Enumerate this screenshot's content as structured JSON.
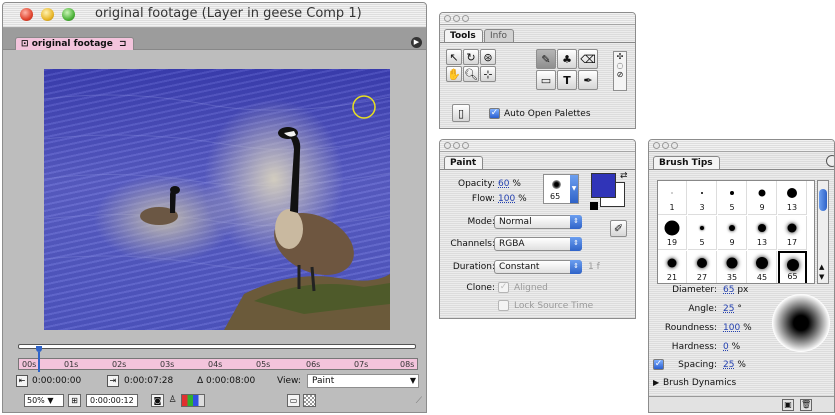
{
  "comp_window": {
    "title": "original footage (Layer in geese Comp 1)",
    "tab_label": "original footage",
    "timeline": {
      "ticks": [
        "00s",
        "01s",
        "02s",
        "03s",
        "04s",
        "05s",
        "06s",
        "07s",
        "08s"
      ]
    },
    "status_row1": {
      "current_time": "0:00:00:00",
      "out_time": "0:00:07:28",
      "duration_prefix": "Δ",
      "duration": "0:00:08:00",
      "view_label": "View:",
      "view_value": "Paint"
    },
    "status_row2": {
      "zoom": "50%",
      "time": "0:00:00:12"
    },
    "colors": {
      "tab_pink": "#f3c4dc",
      "paint_overlay": "#3c3fb5"
    }
  },
  "tools_window": {
    "tabs": [
      "Tools",
      "Info"
    ],
    "auto_open_label": "Auto Open Palettes",
    "auto_open_checked": true,
    "text_tool_glyph": "T"
  },
  "paint_window": {
    "tab_label": "Paint",
    "opacity_label": "Opacity:",
    "opacity_value": "60",
    "opacity_unit": "%",
    "flow_label": "Flow:",
    "flow_value": "100",
    "flow_unit": "%",
    "brush_size": "65",
    "mode_label": "Mode:",
    "mode_value": "Normal",
    "channels_label": "Channels:",
    "channels_value": "RGBA",
    "duration_label": "Duration:",
    "duration_value": "Constant",
    "duration_extra": "1 f",
    "clone_label": "Clone:",
    "aligned_label": "Aligned",
    "lock_source_label": "Lock Source Time",
    "foreground_color": "#3034b8",
    "background_color": "#ffffff"
  },
  "brush_tips_window": {
    "tab_label": "Brush Tips",
    "tips": [
      [
        "1",
        "3",
        "5",
        "9",
        "13"
      ],
      [
        "19",
        "5",
        "9",
        "13",
        "17"
      ],
      [
        "21",
        "27",
        "35",
        "45",
        "65"
      ]
    ],
    "selected_tip": "65",
    "diameter_label": "Diameter:",
    "diameter_value": "65",
    "diameter_unit": "px",
    "angle_label": "Angle:",
    "angle_value": "25",
    "angle_unit": "°",
    "roundness_label": "Roundness:",
    "roundness_value": "100",
    "roundness_unit": "%",
    "hardness_label": "Hardness:",
    "hardness_value": "0",
    "hardness_unit": "%",
    "spacing_label": "Spacing:",
    "spacing_value": "25",
    "spacing_unit": "%",
    "spacing_checked": true,
    "dynamics_label": "Brush Dynamics"
  }
}
